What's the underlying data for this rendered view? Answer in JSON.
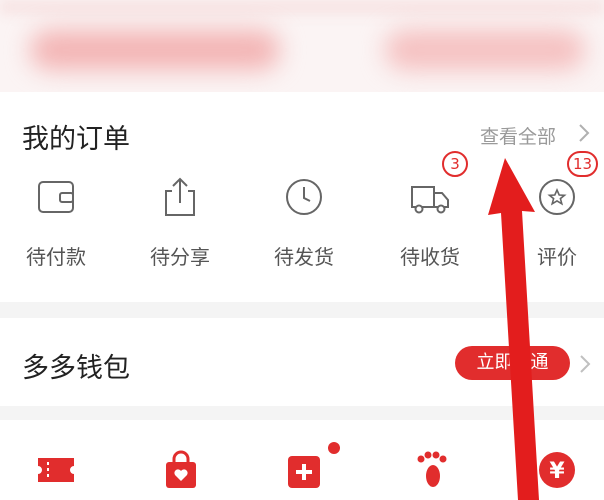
{
  "orders": {
    "title": "我的订单",
    "view_all": "查看全部",
    "items": [
      {
        "label": "待付款",
        "icon": "wallet-icon"
      },
      {
        "label": "待分享",
        "icon": "share-icon"
      },
      {
        "label": "待发货",
        "icon": "clock-icon"
      },
      {
        "label": "待收货",
        "icon": "truck-icon",
        "badge": "3"
      },
      {
        "label": "评价",
        "icon": "review-star-icon",
        "badge": "13"
      }
    ]
  },
  "wallet": {
    "title": "多多钱包",
    "button_label": "立即开通"
  },
  "tools": [
    {
      "icon": "coupon-icon"
    },
    {
      "icon": "shopping-bag-icon"
    },
    {
      "icon": "plus-card-icon"
    },
    {
      "icon": "footprint-icon"
    },
    {
      "icon": "yuan-coin-icon"
    }
  ],
  "colors": {
    "accent": "#e12d2d",
    "text_primary": "#222222",
    "text_secondary": "#555555",
    "text_muted": "#9a9a9a",
    "divider": "#f4f4f4"
  }
}
